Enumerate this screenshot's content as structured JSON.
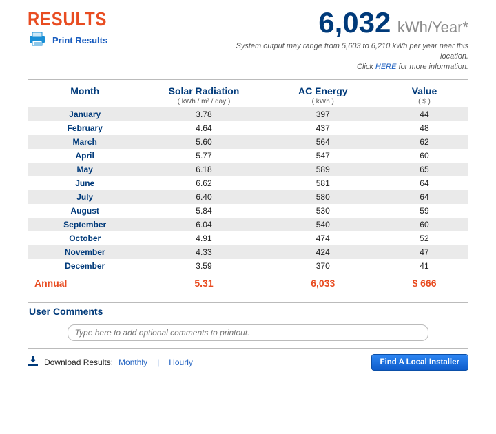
{
  "header": {
    "title": "RESULTS",
    "print_label": "Print Results",
    "big_value": "6,032",
    "big_unit": "kWh/Year*",
    "caption_a": "System output may range from 5,603 to 6,210 kWh per year near this location.",
    "caption_b_pre": "Click ",
    "caption_b_link": "HERE",
    "caption_b_post": " for more information."
  },
  "columns": {
    "c1": "Month",
    "c2": "Solar Radiation",
    "c2_sub": "( kWh / m² / day )",
    "c3": "AC Energy",
    "c3_sub": "( kWh )",
    "c4": "Value",
    "c4_sub": "( $ )"
  },
  "rows": [
    {
      "m": "January",
      "r": "3.78",
      "e": "397",
      "v": "44"
    },
    {
      "m": "February",
      "r": "4.64",
      "e": "437",
      "v": "48"
    },
    {
      "m": "March",
      "r": "5.60",
      "e": "564",
      "v": "62"
    },
    {
      "m": "April",
      "r": "5.77",
      "e": "547",
      "v": "60"
    },
    {
      "m": "May",
      "r": "6.18",
      "e": "589",
      "v": "65"
    },
    {
      "m": "June",
      "r": "6.62",
      "e": "581",
      "v": "64"
    },
    {
      "m": "July",
      "r": "6.40",
      "e": "580",
      "v": "64"
    },
    {
      "m": "August",
      "r": "5.84",
      "e": "530",
      "v": "59"
    },
    {
      "m": "September",
      "r": "6.04",
      "e": "540",
      "v": "60"
    },
    {
      "m": "October",
      "r": "4.91",
      "e": "474",
      "v": "52"
    },
    {
      "m": "November",
      "r": "4.33",
      "e": "424",
      "v": "47"
    },
    {
      "m": "December",
      "r": "3.59",
      "e": "370",
      "v": "41"
    }
  ],
  "annual": {
    "label": "Annual",
    "r": "5.31",
    "e": "6,033",
    "v": "$ 666"
  },
  "comments": {
    "heading": "User Comments",
    "placeholder": "Type here to add optional comments to printout."
  },
  "footer": {
    "dl_label": "Download Results:",
    "monthly": "Monthly",
    "sep": "|",
    "hourly": "Hourly",
    "find_btn": "Find A Local Installer"
  },
  "chart_data": {
    "type": "table",
    "title": "Monthly Solar Output",
    "series": [
      {
        "name": "Solar Radiation (kWh/m²/day)",
        "values": [
          3.78,
          4.64,
          5.6,
          5.77,
          6.18,
          6.62,
          6.4,
          5.84,
          6.04,
          4.91,
          4.33,
          3.59
        ]
      },
      {
        "name": "AC Energy (kWh)",
        "values": [
          397,
          437,
          564,
          547,
          589,
          581,
          580,
          530,
          540,
          474,
          424,
          370
        ]
      },
      {
        "name": "Value ($)",
        "values": [
          44,
          48,
          62,
          60,
          65,
          64,
          64,
          59,
          60,
          52,
          47,
          41
        ]
      }
    ],
    "categories": [
      "January",
      "February",
      "March",
      "April",
      "May",
      "June",
      "July",
      "August",
      "September",
      "October",
      "November",
      "December"
    ],
    "annual": {
      "solar_radiation": 5.31,
      "ac_energy": 6033,
      "value_usd": 666
    },
    "headline_total_kwh_per_year": 6032,
    "range_note": {
      "low": 5603,
      "high": 6210
    }
  }
}
